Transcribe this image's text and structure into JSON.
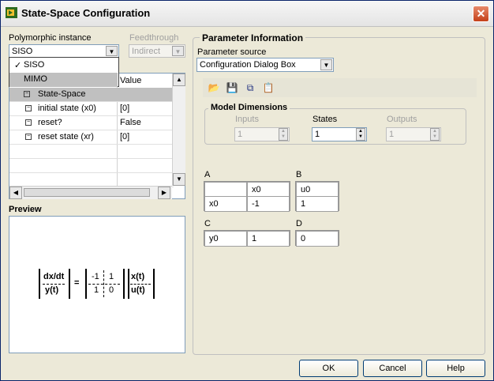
{
  "window": {
    "title": "State-Space Configuration",
    "close_symbol": "✕"
  },
  "left": {
    "polymorphic_label": "Polymorphic instance",
    "polymorphic_value": "SISO",
    "feedthrough_label": "Feedthrough",
    "feedthrough_value": "Indirect",
    "dropdown_items": [
      {
        "label": "SISO",
        "checked": true,
        "check": "✓"
      },
      {
        "label": "MIMO",
        "checked": false,
        "check": ""
      }
    ],
    "tree_header_value": "Value",
    "tree_rows": [
      {
        "name": "State-Space",
        "value": ""
      },
      {
        "name": "initial state (x0)",
        "value": "[0]"
      },
      {
        "name": "reset?",
        "value": "False"
      },
      {
        "name": "reset state (xr)",
        "value": "[0]"
      }
    ],
    "preview_label": "Preview"
  },
  "preview_equation": {
    "lhs_top": "dx/dt",
    "lhs_bottom": "y(t)",
    "equals": "=",
    "A": "-1",
    "B": "1",
    "C": "1",
    "D": "0",
    "rhs_top": "x(t)",
    "rhs_bottom": "u(t)"
  },
  "right": {
    "section_title": "Parameter Information",
    "param_source_label": "Parameter source",
    "param_source_value": "Configuration Dialog Box",
    "model_dims_title": "Model Dimensions",
    "inputs_label": "Inputs",
    "inputs_value": "1",
    "states_label": "States",
    "states_value": "1",
    "outputs_label": "Outputs",
    "outputs_value": "1",
    "A_label": "A",
    "A_col": "x0",
    "A_row": "x0",
    "A_val": "-1",
    "B_label": "B",
    "B_col": "u0",
    "B_val": "1",
    "C_label": "C",
    "C_row": "y0",
    "C_val": "1",
    "D_label": "D",
    "D_val": "0"
  },
  "buttons": {
    "ok": "OK",
    "cancel": "Cancel",
    "help": "Help"
  },
  "colors": {
    "titlebar": "#e4e4e4",
    "selection": "#c0c0c0",
    "close": "#c4401a",
    "panel_bg": "#ece9d8"
  }
}
